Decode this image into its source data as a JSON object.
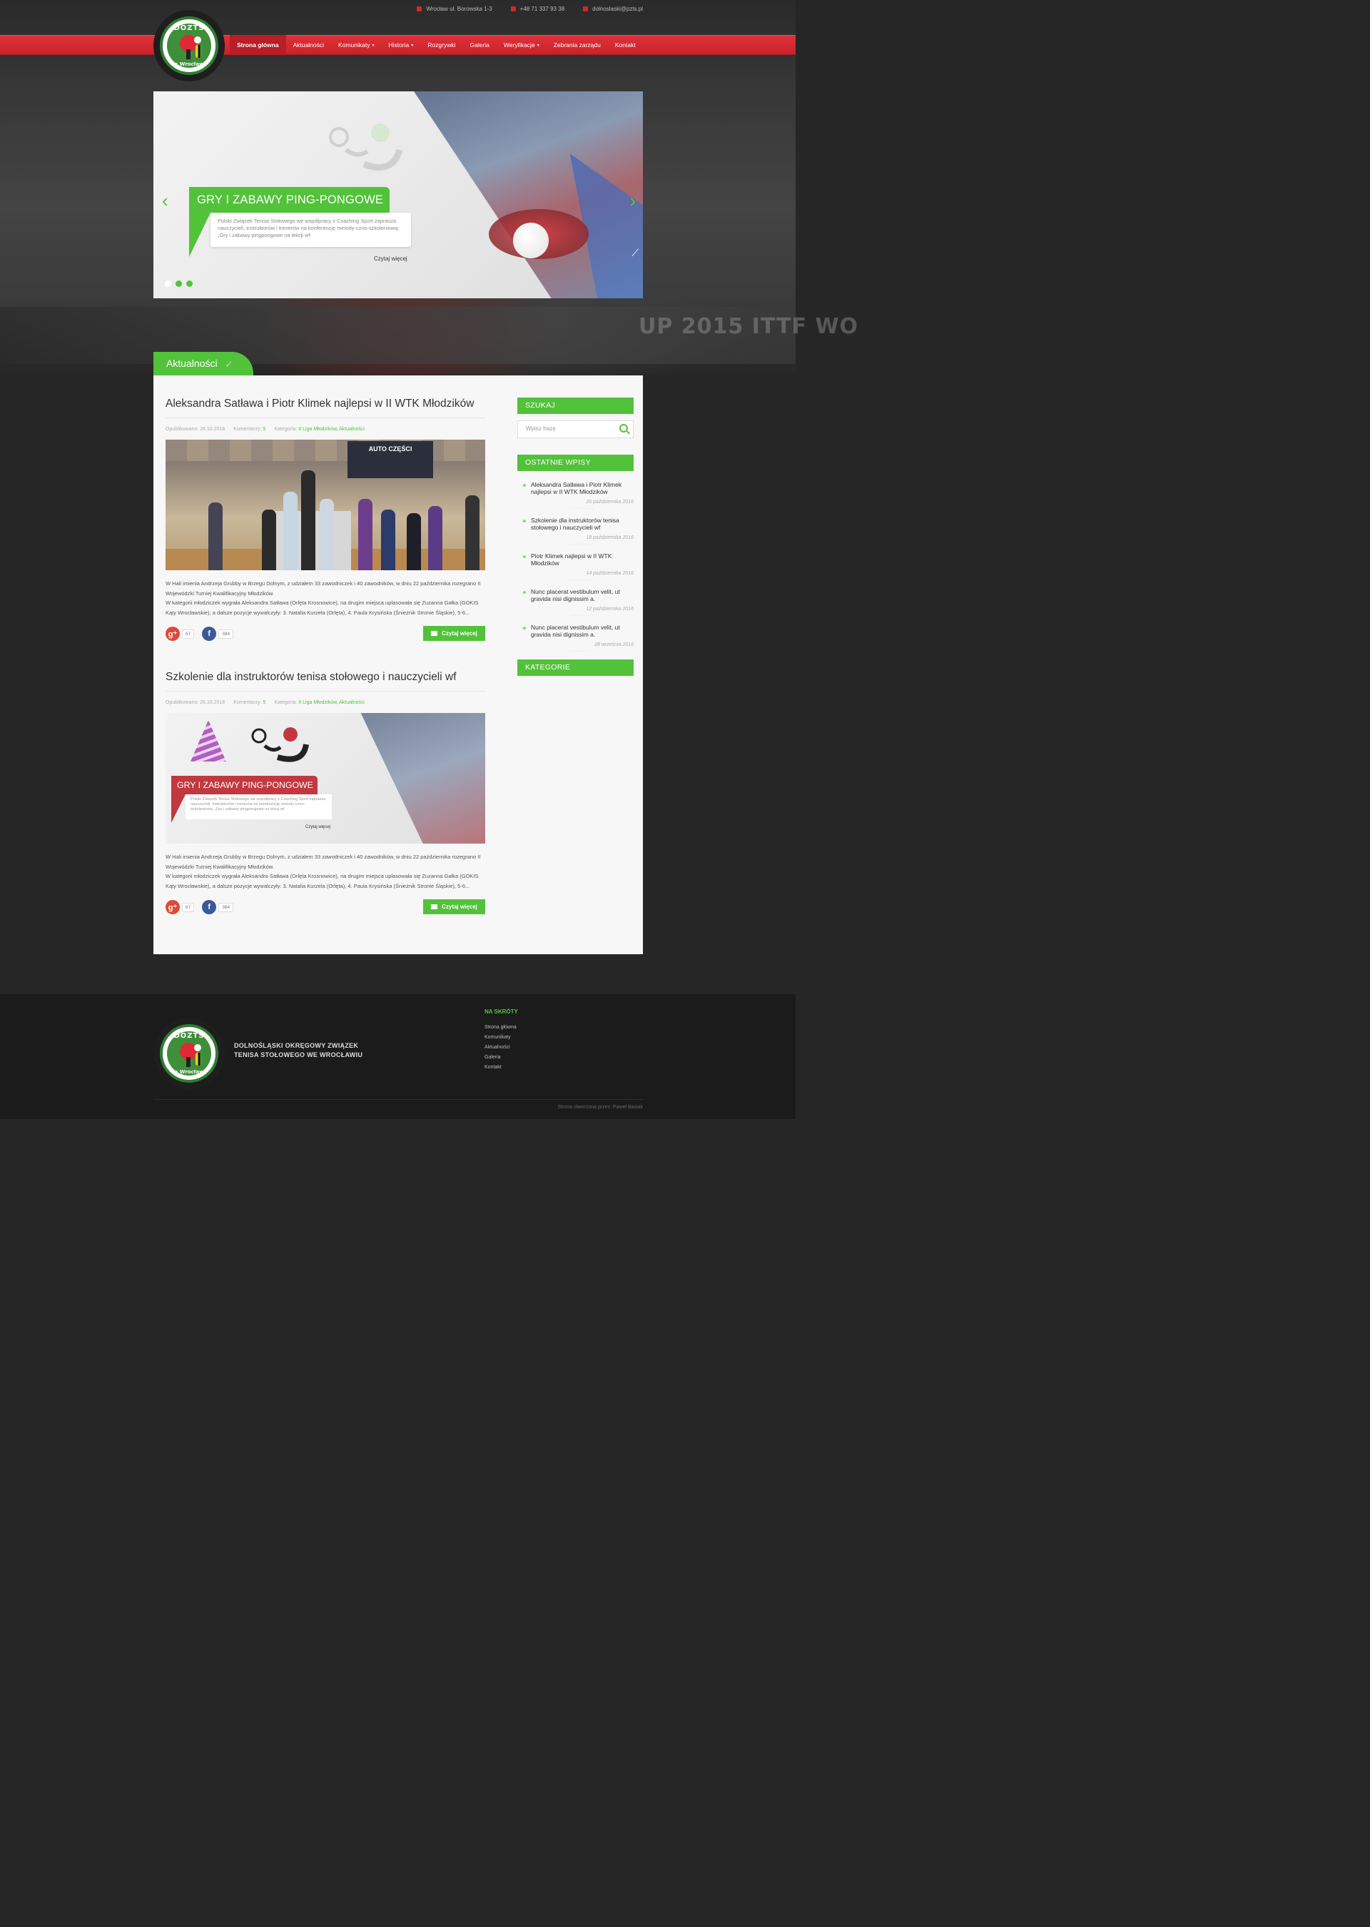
{
  "topbar": {
    "address": "Wrocław ul. Borowska 1-3",
    "phone": "+48 71 337 93 38",
    "email": "dolnoslaski@pzts.pl"
  },
  "logo": {
    "top_text": "DOZTS",
    "bottom_text": "We Wrocławiu"
  },
  "nav": [
    {
      "label": "Strona główna",
      "active": true
    },
    {
      "label": "Aktualności"
    },
    {
      "label": "Komunikaty",
      "caret": "▾"
    },
    {
      "label": "Historia",
      "caret": "▾"
    },
    {
      "label": "Rozgrywki"
    },
    {
      "label": "Galeria"
    },
    {
      "label": "Weryfikacje",
      "caret": "▾"
    },
    {
      "label": "Zebrania zarządu"
    },
    {
      "label": "Kontakt"
    }
  ],
  "background_banner": "UP 2015 ITTF WO",
  "slider": {
    "title": "GRY I ZABAWY PING-PONGOWE",
    "text": "Polski Związek Tenisa Stołowego we współpracy z Coaching Sport zaprasza nauczycieli, instruktorów i trenerów na konferencję metody-czno-szkoleniową: „Gry i zabawy pingpongowe na lekcji wf",
    "more": "Czytaj więcej",
    "prev_icon": "chevron-left-icon",
    "next_icon": "chevron-right-icon",
    "dots_count": 3,
    "active_dot": 1
  },
  "section_title": "Aktualności",
  "posts": [
    {
      "title": "Aleksandra Satława i Piotr Klimek najlepsi w II WTK Młodzików",
      "published": "Opublikowano: 26.10.2016",
      "comments_label": "Komentarzy:",
      "comments": "5",
      "category_label": "Kategoria:",
      "categories": "II Liga Młodzików, Aktualności",
      "banner_text": "AUTO CZĘŚCI",
      "excerpt": "W Hali imienia Andrzeja Grubby w Brzegu Dolnym, z udziałem 33 zawodniczek i 40 zawodników, w dniu 22 października rozegrano II Wojewódzki Turniej Kwalifikacyjny Młodzików.",
      "excerpt2": "W kategorii młodziczek wygrała Aleksandra Satława (Orlęta Krosnowice), na drugim miejsca uplasowała się Zuzanna Gałka (GOKIS Kąty Wrocławskie), a dalsze pozycje wywalczyły: 3. Natalia Kurzela (Orlęta), 4. Paula Krysińska (Śnieżnik Stronie Śląskie), 5-6...",
      "gplus_count": "67",
      "fb_count": "384",
      "more": "Czytaj więcej"
    },
    {
      "title": "Szkolenie dla instruktorów tenisa stołowego i nauczycieli wf",
      "published": "Opublikowano: 26.10.2016",
      "comments_label": "Komentarzy:",
      "comments": "5",
      "category_label": "Kategoria:",
      "categories": "II Liga Młodzików, Aktualności",
      "image_title": "GRY I ZABAWY PING-PONGOWE",
      "image_text": "Polski Związek Tenisa Stołowego we współpracy z Coaching Sport zaprasza nauczycieli, instruktorów i trenerów na konferencję metody-czno-szkoleniową: „Gry i zabawy pingpongowe na lekcji wf",
      "image_more": "Czytaj więcej",
      "excerpt": "W Hali imienia Andrzeja Grubby w Brzegu Dolnym, z udziałem 33 zawodniczek i 40 zawodników, w dniu 22 października rozegrano II Wojewódzki Turniej Kwalifikacyjny Młodzików.",
      "excerpt2": "W kategorii młodziczek wygrała Aleksandra Satława (Orlęta Krosnowice), na drugim miejsca uplasowała się Zuzanna Gałka (GOKIS Kąty Wrocławskie), a dalsze pozycje wywalczyły: 3. Natalia Kurzela (Orlęta), 4. Paula Krysińska (Śnieżnik Stronie Śląskie), 5-6...",
      "gplus_count": "67",
      "fb_count": "384",
      "more": "Czytaj więcej"
    }
  ],
  "sidebar": {
    "search_title": "SZUKAJ",
    "search_placeholder": "Wpisz frazę",
    "recent_title": "OSTATNIE WPISY",
    "recent": [
      {
        "title": "Aleksandra Satława i Piotr Klimek najlepsi w II WTK Młodzików",
        "date": "20 października 2016"
      },
      {
        "title": "Szkolenie dla instruktorów tenisa stołowego i nauczycieli wf",
        "date": "18 października 2016"
      },
      {
        "title": "Piotr Klimek najlepsi w II WTK Młodzików",
        "date": "14 października 2016"
      },
      {
        "title": "Nunc placerat vestibulum velit, ut gravida nisi dignissim a.",
        "date": "12 października 2016"
      },
      {
        "title": "Nunc placerat vestibulum velit, ut gravida nisi dignissim a.",
        "date": "28 września 2016"
      }
    ],
    "categories_title": "KATEGORIE"
  },
  "footer": {
    "org_line1": "DOLNOŚLĄSKI OKRĘGOWY ZWIĄZEK",
    "org_line2": "TENISA STOŁOWEGO WE WROCŁAWIU",
    "shortcuts_title": "NA SKRÓTY",
    "links": [
      "Strona główna",
      "Komunikaty",
      "Aktualności",
      "Galeria",
      "Kontakt"
    ],
    "credit": "Strona stworzona przez: Paweł Basiak"
  },
  "colors": {
    "accent_green": "#52c23a",
    "nav_red": "#d4262f",
    "background": "#262626"
  }
}
